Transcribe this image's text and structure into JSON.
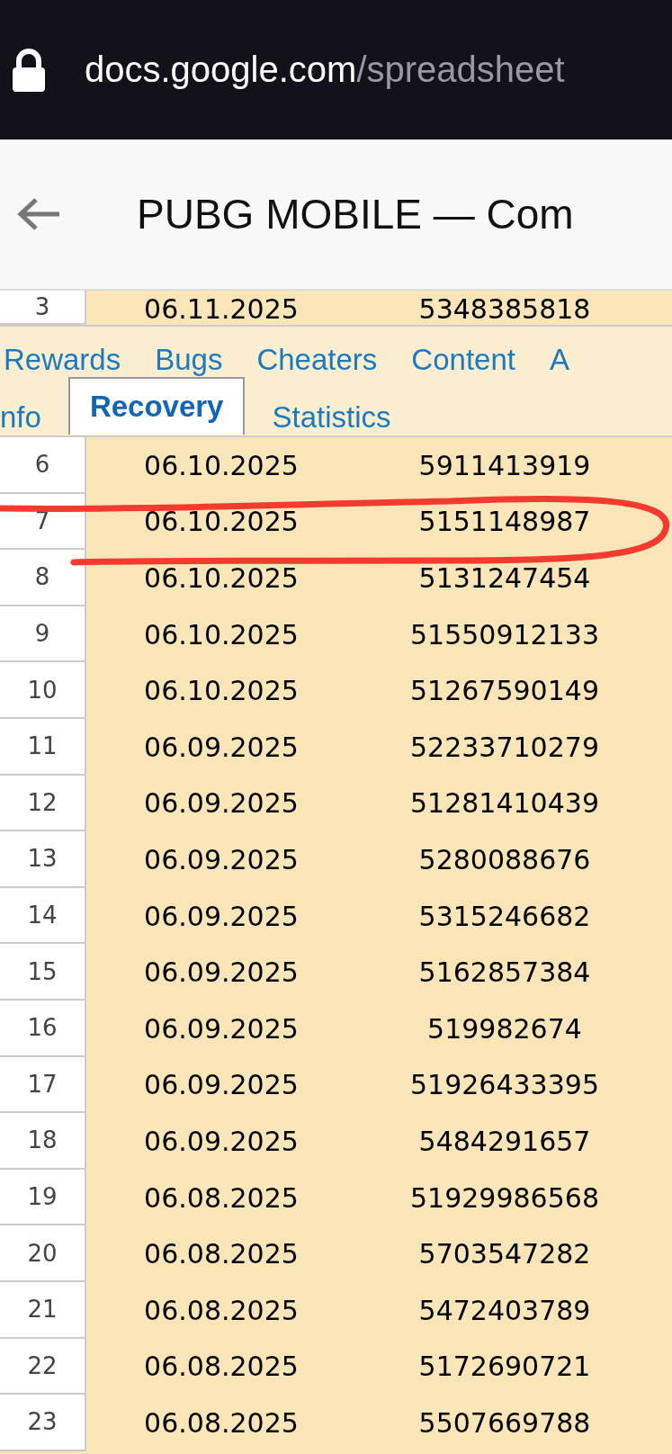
{
  "browser": {
    "domain": "docs.google.com",
    "path": "/spreadsheet"
  },
  "header": {
    "title": "PUBG MOBILE — Com"
  },
  "rows_top": [
    {
      "number": "3",
      "date": "06.11.2025",
      "id": "5348385818"
    }
  ],
  "tab_rows": [
    [
      {
        "label": "Rewards",
        "selected": false
      },
      {
        "label": "Bugs",
        "selected": false
      },
      {
        "label": "Cheaters",
        "selected": false
      },
      {
        "label": "Content",
        "selected": false
      },
      {
        "label": "A",
        "selected": false
      }
    ],
    [
      {
        "label": "nfo",
        "selected": false
      },
      {
        "label": "Recovery",
        "selected": true
      },
      {
        "label": "Statistics",
        "selected": false
      }
    ]
  ],
  "rows": [
    {
      "number": "6",
      "date": "06.10.2025",
      "id": "5911413919"
    },
    {
      "number": "7",
      "date": "06.10.2025",
      "id": "5151148987"
    },
    {
      "number": "8",
      "date": "06.10.2025",
      "id": "5131247454"
    },
    {
      "number": "9",
      "date": "06.10.2025",
      "id": "51550912133"
    },
    {
      "number": "10",
      "date": "06.10.2025",
      "id": "51267590149"
    },
    {
      "number": "11",
      "date": "06.09.2025",
      "id": "52233710279"
    },
    {
      "number": "12",
      "date": "06.09.2025",
      "id": "51281410439"
    },
    {
      "number": "13",
      "date": "06.09.2025",
      "id": "5280088676"
    },
    {
      "number": "14",
      "date": "06.09.2025",
      "id": "5315246682"
    },
    {
      "number": "15",
      "date": "06.09.2025",
      "id": "5162857384"
    },
    {
      "number": "16",
      "date": "06.09.2025",
      "id": "519982674"
    },
    {
      "number": "17",
      "date": "06.09.2025",
      "id": "51926433395"
    },
    {
      "number": "18",
      "date": "06.09.2025",
      "id": "5484291657"
    },
    {
      "number": "19",
      "date": "06.08.2025",
      "id": "51929986568"
    },
    {
      "number": "20",
      "date": "06.08.2025",
      "id": "5703547282"
    },
    {
      "number": "21",
      "date": "06.08.2025",
      "id": "5472403789"
    },
    {
      "number": "22",
      "date": "06.08.2025",
      "id": "5172690721"
    },
    {
      "number": "23",
      "date": "06.08.2025",
      "id": "5507669788"
    }
  ]
}
